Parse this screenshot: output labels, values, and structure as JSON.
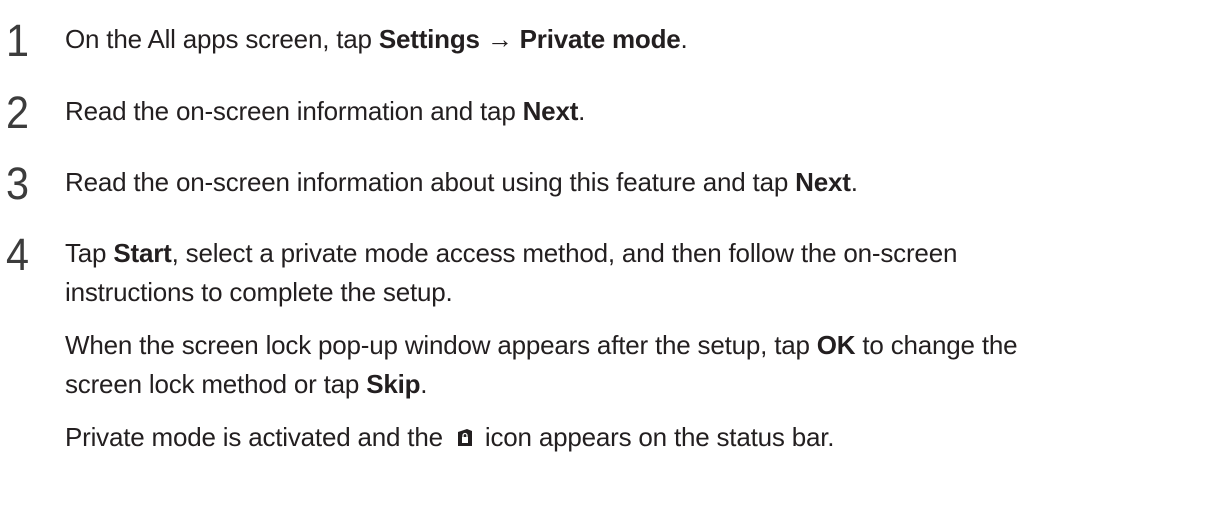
{
  "steps": [
    {
      "number": "1",
      "lines": [
        {
          "t1": "On the All apps screen, tap ",
          "b1": "Settings",
          "t2": " → ",
          "b2": "Private mode",
          "t3": "."
        }
      ]
    },
    {
      "number": "2",
      "lines": [
        {
          "t1": "Read the on-screen information and tap ",
          "b1": "Next",
          "t2": "."
        }
      ]
    },
    {
      "number": "3",
      "lines": [
        {
          "t1": "Read the on-screen information about using this feature and tap ",
          "b1": "Next",
          "t2": "."
        }
      ]
    },
    {
      "number": "4",
      "lines": [
        {
          "t1": "Tap ",
          "b1": "Start",
          "t2": ", select a private mode access method, and then follow the on-screen"
        },
        {
          "t1": "instructions to complete the setup."
        },
        {
          "t1": "When the screen lock pop-up window appears after the setup, tap ",
          "b1": "OK",
          "t2": " to change the"
        },
        {
          "t1": "screen lock method or tap ",
          "b1": "Skip",
          "t2": "."
        },
        {
          "t1": "Private mode is activated and the ",
          "icon": "private-mode-status-icon",
          "t2": " icon appears on the status bar."
        }
      ]
    }
  ]
}
